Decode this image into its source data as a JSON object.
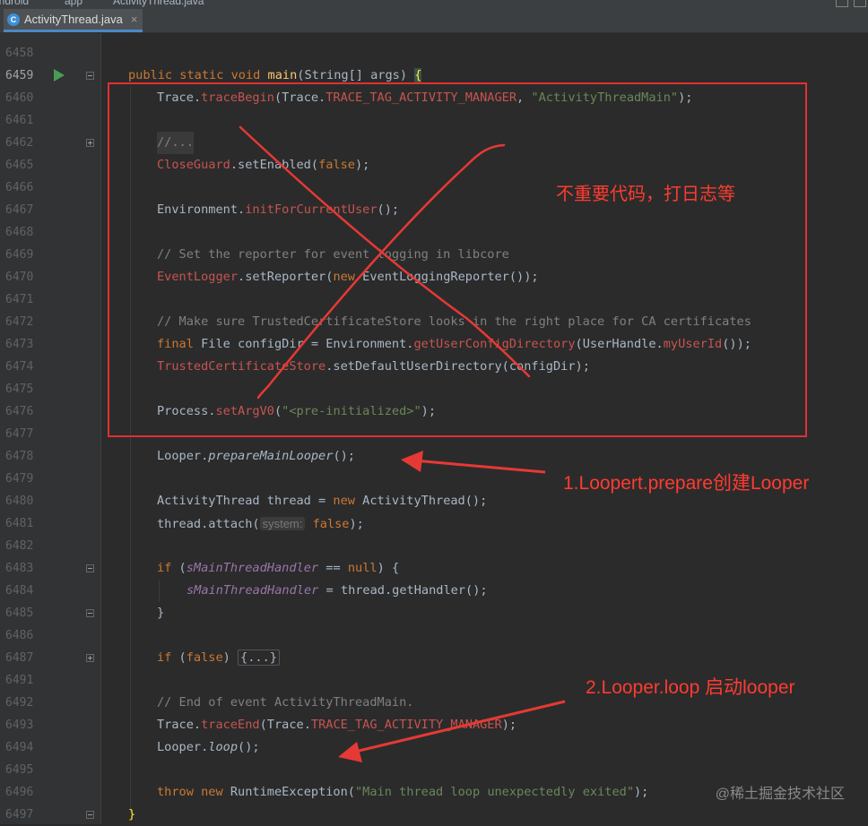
{
  "breadcrumb": {
    "project": "android",
    "module": "app",
    "file": "ActivityThread.java"
  },
  "tab": {
    "label": "ActivityThread.java",
    "icon": "java-class-icon"
  },
  "lines": [
    {
      "n": "6458"
    },
    {
      "n": "6459"
    },
    {
      "n": "6460"
    },
    {
      "n": "6461"
    },
    {
      "n": "6462"
    },
    {
      "n": "6465"
    },
    {
      "n": "6466"
    },
    {
      "n": "6467"
    },
    {
      "n": "6468"
    },
    {
      "n": "6469"
    },
    {
      "n": "6470"
    },
    {
      "n": "6471"
    },
    {
      "n": "6472"
    },
    {
      "n": "6473"
    },
    {
      "n": "6474"
    },
    {
      "n": "6475"
    },
    {
      "n": "6476"
    },
    {
      "n": "6477"
    },
    {
      "n": "6478"
    },
    {
      "n": "6479"
    },
    {
      "n": "6480"
    },
    {
      "n": "6481"
    },
    {
      "n": "6482"
    },
    {
      "n": "6483"
    },
    {
      "n": "6484"
    },
    {
      "n": "6485"
    },
    {
      "n": "6486"
    },
    {
      "n": "6487"
    },
    {
      "n": "6491"
    },
    {
      "n": "6492"
    },
    {
      "n": "6493"
    },
    {
      "n": "6494"
    },
    {
      "n": "6495"
    },
    {
      "n": "6496"
    },
    {
      "n": "6497"
    }
  ],
  "code": {
    "main_sig": [
      "public",
      "static",
      "void",
      "main",
      "(String[] args)",
      "{"
    ],
    "trace_begin": [
      "Trace.",
      "traceBegin",
      "(Trace.",
      "TRACE_TAG_ACTIVITY_MANAGER",
      ", ",
      "\"ActivityThreadMain\"",
      ");"
    ],
    "folded_comment": "//...",
    "close_guard": [
      "CloseGuard",
      ".setEnabled(",
      "false",
      ");"
    ],
    "env_init": [
      "Environment.",
      "initForCurrentUser",
      "();"
    ],
    "comment_reporter": "// Set the reporter for event logging in libcore",
    "event_logger": [
      "EventLogger",
      ".setReporter(",
      "new",
      " EventLoggingReporter());"
    ],
    "comment_certs": "// Make sure TrustedCertificateStore looks in the right place for CA certificates",
    "config_dir": [
      "final",
      " File configDir = Environment.",
      "getUserConfigDirectory",
      "(UserHandle.",
      "myUserId",
      "());"
    ],
    "trusted_store": [
      "TrustedCertificateStore",
      ".setDefaultUserDirectory(configDir);"
    ],
    "set_argv0": [
      "Process.",
      "setArgV0",
      "(",
      "\"<pre-initialized>\"",
      ");"
    ],
    "prepare_looper": [
      "Looper.",
      "prepareMainLooper",
      "();"
    ],
    "new_thread": [
      "ActivityThread thread = ",
      "new",
      " ActivityThread();"
    ],
    "attach": [
      "thread.attach(",
      "system:",
      "false",
      ");"
    ],
    "if_handler": [
      "if",
      " (",
      "sMainThreadHandler",
      " == ",
      "null",
      ") {"
    ],
    "assign_handler": [
      "sMainThreadHandler",
      " = thread.getHandler();"
    ],
    "close_brace": "}",
    "if_false": [
      "if",
      " (",
      "false",
      ") ",
      "{...}"
    ],
    "comment_end": "// End of event ActivityThreadMain.",
    "trace_end": [
      "Trace.",
      "traceEnd",
      "(Trace.",
      "TRACE_TAG_ACTIVITY_MANAGER",
      ");"
    ],
    "looper_loop": [
      "Looper.",
      "loop",
      "();"
    ],
    "throw_line": [
      "throw",
      " ",
      "new",
      " RuntimeException(",
      "\"Main thread loop unexpectedly exited\"",
      ");"
    ],
    "final_brace": "}"
  },
  "annotations": {
    "unimportant": "不重要代码，打日志等",
    "prepare": "1.Loopert.prepare创建Looper",
    "loop": "2.Looper.loop  启动looper"
  },
  "watermark": "@稀土掘金技术社区",
  "colors": {
    "background": "#2b2b2b",
    "gutter": "#313335",
    "keyword": "#cc7832",
    "method": "#ffc66d",
    "string": "#6a8759",
    "comment": "#808080",
    "static_field": "#9876aa",
    "error_red": "#c75450",
    "annotation": "#ff3b30"
  }
}
